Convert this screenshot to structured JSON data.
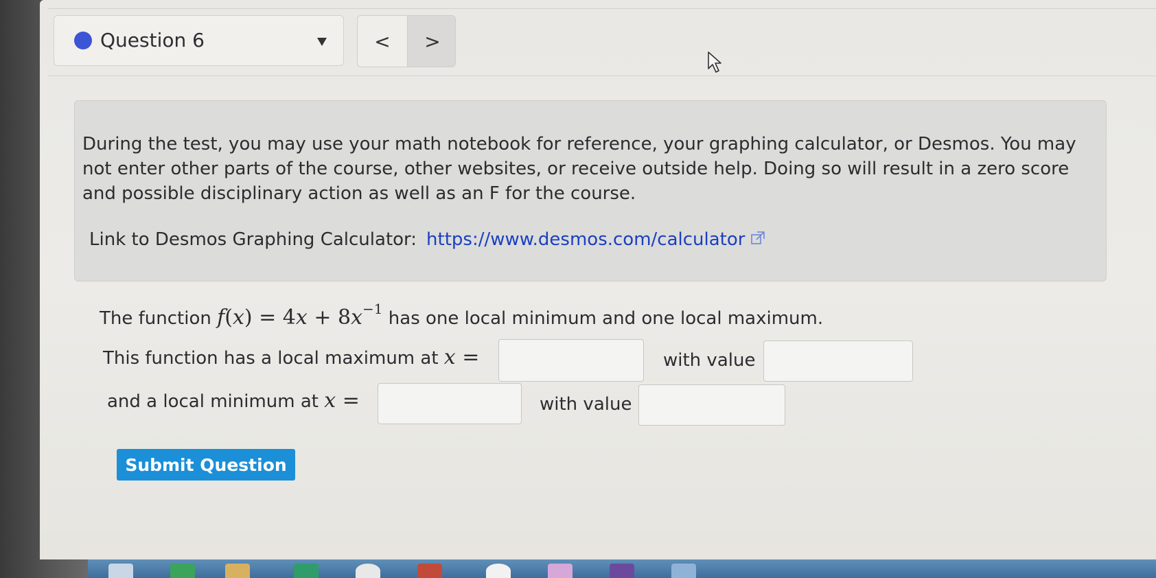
{
  "header": {
    "question_label": "Question 6",
    "prev_label": "<",
    "next_label": ">"
  },
  "notice": {
    "text": "During the test, you may use your math notebook for reference, your graphing calculator, or Desmos.  You may not enter other parts of the course, other websites, or receive outside help.  Doing so will result in a zero score and possible disciplinary action as well as an F for the course.",
    "link_prefix": "Link to Desmos Graphing Calculator:",
    "link_text": "https://www.desmos.com/calculator"
  },
  "question": {
    "intro": "The function",
    "function_name": "f",
    "variable": "x",
    "coef_1": "4",
    "coef_2": "8",
    "exponent": "−1",
    "suffix": "has one local minimum and one local maximum.",
    "max_prefix": "This function has a local maximum at",
    "min_prefix": "and a local minimum at",
    "with_value_label": "with value",
    "equals": "="
  },
  "answers": {
    "max_x": "",
    "max_value": "",
    "min_x": "",
    "min_value": ""
  },
  "submit_label": "Submit Question",
  "colors": {
    "status_dot": "#3c55d6",
    "link": "#1a3fc0",
    "submit": "#1b8fd8"
  }
}
